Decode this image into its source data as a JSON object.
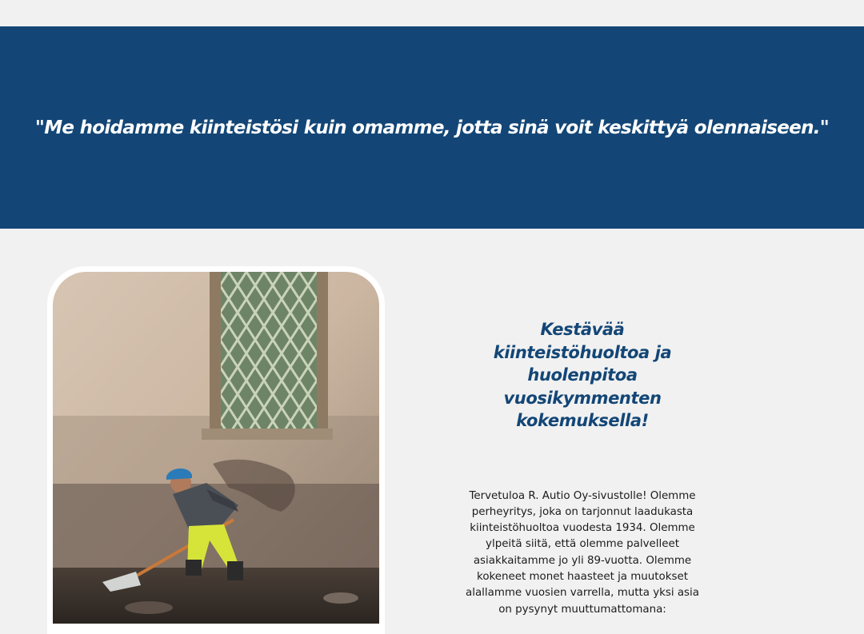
{
  "hero": {
    "quote": "\"Me hoidamme kiinteistösi kuin omamme, jotta sinä voit keskittyä olennaiseen.\""
  },
  "about": {
    "image_icon": "worker-shoveling-photo",
    "headline": "Kestävää kiinteistöhuoltoa ja huolenpitoa vuosikymmenten kokemuksella!",
    "intro": "Tervetuloa R. Autio Oy-sivustolle! Olemme perheyritys, joka on tarjonnut laadukasta kiinteistöhuoltoa vuodesta 1934. Olemme ylpeitä siitä, että olemme palvelleet asiakkaitamme jo yli 89-vuotta. Olemme kokeneet monet haasteet ja muutokset alallamme vuosien varrella, mutta yksi asia on pysynyt muuttumattomana:"
  },
  "colors": {
    "brand_blue": "#134676",
    "page_background": "#f1f1f1",
    "text_dark": "#1b1b1b"
  }
}
